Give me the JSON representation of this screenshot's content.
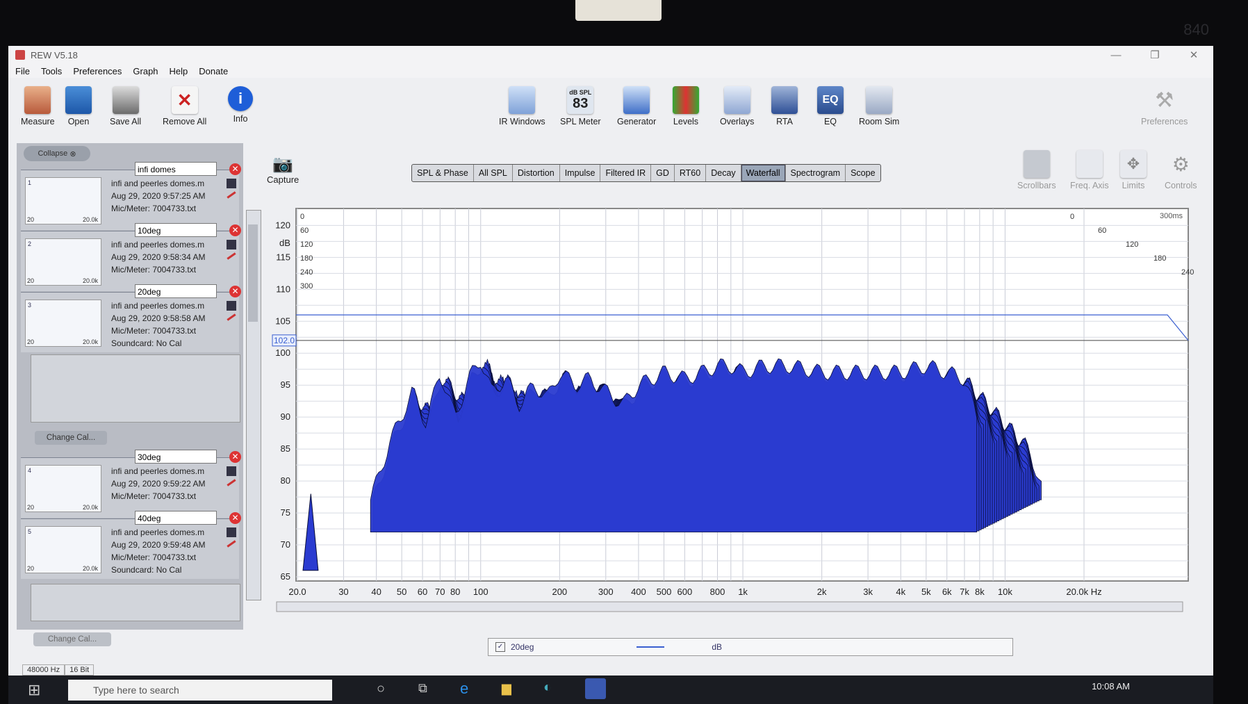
{
  "window": {
    "title": "REW V5.18",
    "controls": [
      "—",
      "❐",
      "✕"
    ]
  },
  "menu": [
    "File",
    "Tools",
    "Preferences",
    "Graph",
    "Help",
    "Donate"
  ],
  "toolbar_left": [
    {
      "label": "Measure",
      "icon": "measure-icon"
    },
    {
      "label": "Open",
      "icon": "folder-open-icon"
    },
    {
      "label": "Save All",
      "icon": "save-all-icon"
    },
    {
      "label": "Remove All",
      "icon": "remove-all-icon"
    },
    {
      "label": "Info",
      "icon": "info-icon"
    }
  ],
  "toolbar_center": [
    {
      "label": "IR Windows",
      "icon": "ir-windows-icon"
    },
    {
      "label": "SPL Meter",
      "icon": "spl-meter-icon",
      "top": "dB SPL",
      "value": "83"
    },
    {
      "label": "Generator",
      "icon": "generator-icon"
    },
    {
      "label": "Levels",
      "icon": "levels-icon"
    },
    {
      "label": "Overlays",
      "icon": "overlays-icon"
    },
    {
      "label": "RTA",
      "icon": "rta-icon"
    },
    {
      "label": "EQ",
      "icon": "eq-icon"
    },
    {
      "label": "Room Sim",
      "icon": "room-sim-icon"
    }
  ],
  "toolbar_right": {
    "preferences": "Preferences"
  },
  "graph_controls": [
    {
      "label": "Scrollbars",
      "icon": "scrollbars-icon"
    },
    {
      "label": "Freq. Axis",
      "icon": "freq-axis-icon"
    },
    {
      "label": "Limits",
      "icon": "limits-icon"
    },
    {
      "label": "Controls",
      "icon": "controls-gear-icon"
    }
  ],
  "tabs": [
    "SPL & Phase",
    "All SPL",
    "Distortion",
    "Impulse",
    "Filtered IR",
    "GD",
    "RT60",
    "Decay",
    "Waterfall",
    "Spectrogram",
    "Scope"
  ],
  "active_tab": "Waterfall",
  "capture_label": "Capture",
  "collapse_label": "Collapse",
  "measurements": [
    {
      "num": "1",
      "name": "infi domes",
      "file": "infi and peerles domes.m",
      "date": "Aug 29, 2020 9:57:25 AM",
      "mic": "Mic/Meter: 7004733.txt",
      "range_lo": "20",
      "range_hi": "20.0k"
    },
    {
      "num": "2",
      "name": "10deg",
      "file": "infi and peerles domes.m",
      "date": "Aug 29, 2020 9:58:34 AM",
      "mic": "Mic/Meter: 7004733.txt",
      "range_lo": "20",
      "range_hi": "20.0k"
    },
    {
      "num": "3",
      "name": "20deg",
      "file": "infi and peerles domes.m",
      "date": "Aug 29, 2020 9:58:58 AM",
      "mic": "Mic/Meter: 7004733.txt",
      "sound": "Soundcard: No Cal",
      "range_lo": "20",
      "range_hi": "20.0k"
    },
    {
      "num": "4",
      "name": "30deg",
      "file": "infi and peerles domes.m",
      "date": "Aug 29, 2020 9:59:22 AM",
      "mic": "Mic/Meter: 7004733.txt",
      "range_lo": "20",
      "range_hi": "20.0k"
    },
    {
      "num": "5",
      "name": "40deg",
      "file": "infi and peerles domes.m",
      "date": "Aug 29, 2020 9:59:48 AM",
      "mic": "Mic/Meter: 7004733.txt",
      "sound": "Soundcard: No Cal",
      "range_lo": "20",
      "range_hi": "20.0k"
    }
  ],
  "change_cal": "Change Cal...",
  "legend": {
    "name": "20deg",
    "unit": "dB"
  },
  "status": [
    "48000 Hz",
    "16 Bit"
  ],
  "taskbar": {
    "search": "Type here to search",
    "time": "10:08 AM"
  },
  "bezel_number": "840",
  "chart_data": {
    "type": "area",
    "ylabel": "dB",
    "y_ticks": [
      120,
      115,
      110,
      105,
      100,
      95,
      90,
      85,
      80,
      75,
      70,
      65
    ],
    "ylim": [
      65,
      122
    ],
    "cursor_level": "102.0",
    "x_ticks": [
      "20.0",
      "30",
      "40",
      "50",
      "60",
      "70",
      "80",
      "100",
      "200",
      "300",
      "400",
      "500",
      "600",
      "800",
      "1k",
      "2k",
      "3k",
      "4k",
      "5k",
      "6k",
      "7k",
      "8k",
      "10k",
      "20.0k Hz"
    ],
    "xlim": [
      20,
      20000
    ],
    "x_scale": "log",
    "time_labels_left": [
      "0",
      "60",
      "120",
      "180",
      "240",
      "300"
    ],
    "time_labels_right": [
      "0",
      "60",
      "120",
      "180",
      "240",
      "300"
    ],
    "time_max_label": "300ms",
    "series_color": "#2a3bd0",
    "front_slice": {
      "freq_hz": [
        38,
        45,
        55,
        62,
        70,
        80,
        90,
        100,
        110,
        125,
        140,
        160,
        180,
        200,
        230,
        260,
        300,
        350,
        400,
        450,
        500,
        600,
        700,
        800,
        900,
        1000,
        1200,
        1500,
        2000,
        2500,
        3000,
        4000,
        5000,
        6000,
        7000,
        7800
      ],
      "db": [
        77,
        86,
        94,
        89,
        97,
        90,
        96,
        99,
        94,
        96,
        92,
        95,
        93,
        97,
        95,
        96,
        94,
        92,
        95,
        96,
        97,
        96,
        97,
        98,
        98,
        97,
        98,
        98,
        97,
        97,
        97,
        97,
        98,
        97,
        96,
        90
      ]
    },
    "slices": 30,
    "slice_step_ms": 10,
    "decay_db_per_slice": 0.55
  }
}
